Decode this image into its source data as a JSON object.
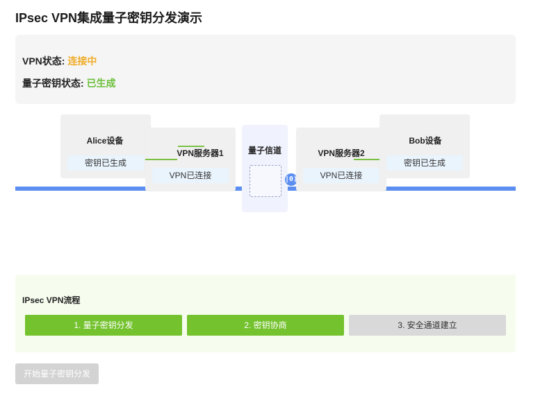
{
  "page": {
    "title": "IPsec VPN集成量子密钥分发演示"
  },
  "status": {
    "vpn_label": "VPN状态:",
    "vpn_value": "连接中",
    "key_label": "量子密钥状态:",
    "key_value": "已生成"
  },
  "nodes": {
    "alice": {
      "title": "Alice设备",
      "status": "密钥已生成"
    },
    "vpn1": {
      "title": "VPN服务器1",
      "status": "VPN已连接"
    },
    "channel": {
      "title": "量子信道"
    },
    "vpn2": {
      "title": "VPN服务器2",
      "status": "VPN已连接"
    },
    "bob": {
      "title": "Bob设备",
      "status": "密钥已生成"
    }
  },
  "photon": {
    "label": "|0⟩"
  },
  "flow": {
    "title": "IPsec VPN流程",
    "steps": [
      {
        "label": "1. 量子密钥分发",
        "state": "done"
      },
      {
        "label": "2. 密钥协商",
        "state": "done"
      },
      {
        "label": "3. 安全通道建立",
        "state": "pending"
      }
    ]
  },
  "actions": {
    "start_label": "开始量子密钥分发"
  },
  "colors": {
    "connecting": "#f0ad2b",
    "generated": "#6cbf3a",
    "track": "#5b8ef0",
    "step_done": "#74c22e",
    "step_pending": "#d9d9d9"
  }
}
